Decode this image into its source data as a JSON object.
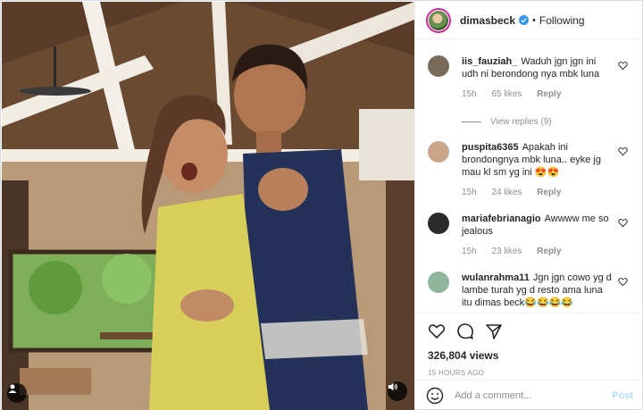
{
  "post": {
    "username": "dimasbeck",
    "separator": "•",
    "follow_status": "Following",
    "views": "326,804 views",
    "time_ago": "15 HOURS AGO"
  },
  "comments": [
    {
      "user": "iis_fauziah_",
      "text": "Waduh jgn jgn ini udh ni berondong nya mbk luna",
      "age": "15h",
      "likes": "65 likes",
      "reply": "Reply",
      "avatar_color": "#7a6a5a"
    },
    {
      "user": "puspita6365",
      "text": "Apakah ini brondongnya mbk luna.. eyke jg mau kl sm yg ini 😍😍",
      "age": "15h",
      "likes": "24 likes",
      "reply": "Reply",
      "avatar_color": "#c9a58a"
    },
    {
      "user": "mariafebrianagio",
      "text": "Awwww me so jealous",
      "age": "15h",
      "likes": "23 likes",
      "reply": "Reply",
      "avatar_color": "#2a2a2a"
    },
    {
      "user": "wulanrahma11",
      "text": "Jgn jgn cowo yg d lambe turah yg d resto ama luna itu dimas beck😂😂😂😂",
      "age": "",
      "likes": "",
      "reply": "",
      "avatar_color": "#8fb59a"
    }
  ],
  "view_replies": "View replies (9)",
  "add_comment": {
    "placeholder": "Add a comment...",
    "post_label": "Post"
  },
  "icons": [
    "heart-icon",
    "comment-icon",
    "share-icon",
    "emoji-icon",
    "verified-badge-icon",
    "user-tag-icon",
    "sound-icon"
  ],
  "colors": {
    "verified": "#3897f0",
    "post_disabled": "#b3dbff",
    "meta_gray": "#8e8e8e"
  }
}
